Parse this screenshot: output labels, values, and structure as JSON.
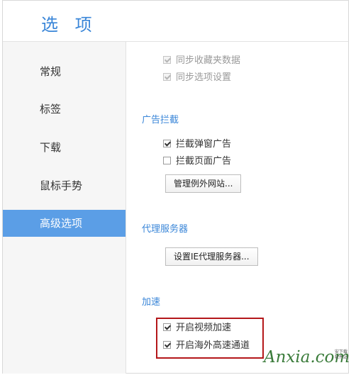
{
  "window": {
    "title": "选 项"
  },
  "sidebar": {
    "items": [
      {
        "label": "常规",
        "active": false
      },
      {
        "label": "标签",
        "active": false
      },
      {
        "label": "下载",
        "active": false
      },
      {
        "label": "鼠标手势",
        "active": false
      },
      {
        "label": "高级选项",
        "active": true
      }
    ]
  },
  "sync": {
    "options": [
      {
        "label": "同步收藏夹数据",
        "checked": true,
        "disabled": true
      },
      {
        "label": "同步选项设置",
        "checked": true,
        "disabled": true
      }
    ]
  },
  "adblock": {
    "title": "广告拦截",
    "options": [
      {
        "label": "拦截弹窗广告",
        "checked": true
      },
      {
        "label": "拦截页面广告",
        "checked": false
      }
    ],
    "manage_button": "管理例外网站..."
  },
  "proxy": {
    "title": "代理服务器",
    "button": "设置IE代理服务器..."
  },
  "accel": {
    "title": "加速",
    "options": [
      {
        "label": "开启视频加速",
        "checked": true
      },
      {
        "label": "开启海外高速通道",
        "checked": true
      }
    ]
  },
  "watermark": {
    "text": "Anxia.com",
    "sub1": "安下载",
    "sub2": "软件站"
  },
  "colors": {
    "accent": "#3a86d8",
    "active_nav": "#5b9ee6",
    "highlight": "#b4171a"
  }
}
